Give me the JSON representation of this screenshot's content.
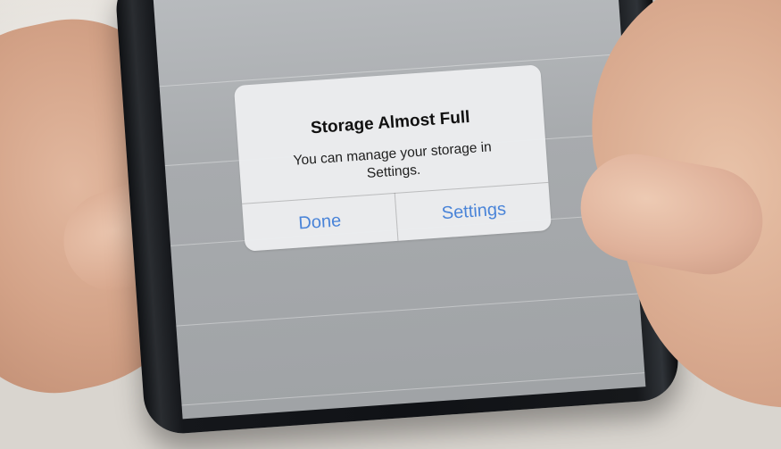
{
  "dialog": {
    "title": "Storage Almost Full",
    "message": "You can manage your storage in Settings.",
    "buttons": {
      "done": "Done",
      "settings": "Settings"
    }
  },
  "colors": {
    "button_text": "#4a84d8",
    "screen_bg": "#a8abae",
    "dialog_bg": "#ecedef"
  }
}
